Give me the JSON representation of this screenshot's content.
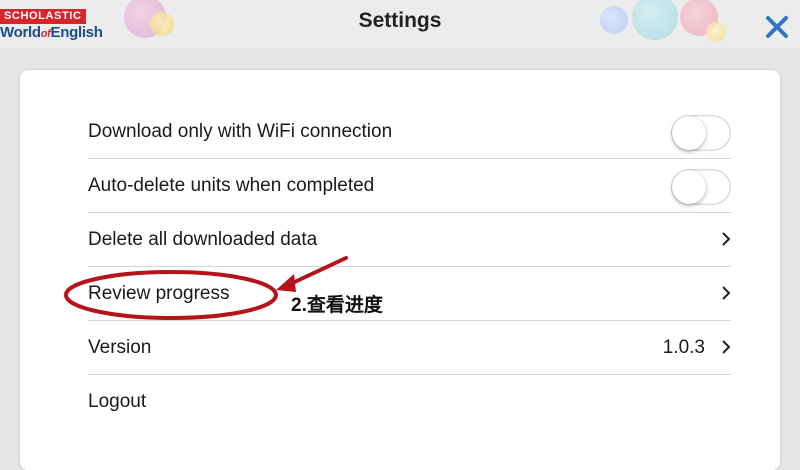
{
  "logo": {
    "top": "SCHOLASTIC",
    "bottom_world": "World",
    "bottom_of": "of",
    "bottom_english": "English"
  },
  "header": {
    "title": "Settings",
    "close_icon": "close-icon"
  },
  "settings": {
    "rows": [
      {
        "label": "Download only with WiFi connection",
        "control": "toggle",
        "state": "off"
      },
      {
        "label": "Auto-delete units when completed",
        "control": "toggle",
        "state": "off"
      },
      {
        "label": "Delete all downloaded data",
        "control": "chevron"
      },
      {
        "label": "Review progress",
        "control": "chevron"
      },
      {
        "label": "Version",
        "value": "1.0.3",
        "control": "chevron"
      },
      {
        "label": "Logout",
        "control": "none"
      }
    ]
  },
  "annotation": {
    "text": "2.查看进度",
    "color": "#b4131a"
  },
  "colors": {
    "accent_blue": "#2f74c7",
    "annotation_red": "#b4131a",
    "background": "#e6e6e6"
  }
}
